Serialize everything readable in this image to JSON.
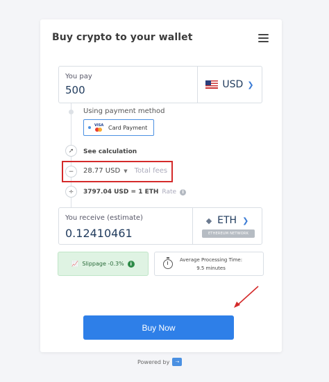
{
  "header": {
    "title": "Buy crypto to your wallet"
  },
  "pay": {
    "label": "You pay",
    "amount": "500",
    "currency": "USD"
  },
  "payment_method": {
    "label": "Using payment method",
    "visa_text": "VISA",
    "option": "Card Payment"
  },
  "calculation": {
    "link": "See calculation"
  },
  "fees": {
    "amount": "28.77 USD",
    "label": "Total fees"
  },
  "rate": {
    "value": "3797.04 USD = 1 ETH",
    "label": "Rate"
  },
  "receive": {
    "label": "You receive (estimate)",
    "amount": "0.12410461",
    "currency": "ETH",
    "network": "ETHEREUM NETWORK"
  },
  "slippage": {
    "text": "Slippage -0.3%"
  },
  "processing": {
    "line1": "Average Processing Time:",
    "line2": "9.5 minutes"
  },
  "actions": {
    "buy_label": "Buy Now"
  },
  "footer": {
    "powered_label": "Powered by"
  },
  "colors": {
    "accent": "#2e7fe8",
    "highlight": "#d42a2a",
    "success_bg": "#dff3e3"
  }
}
